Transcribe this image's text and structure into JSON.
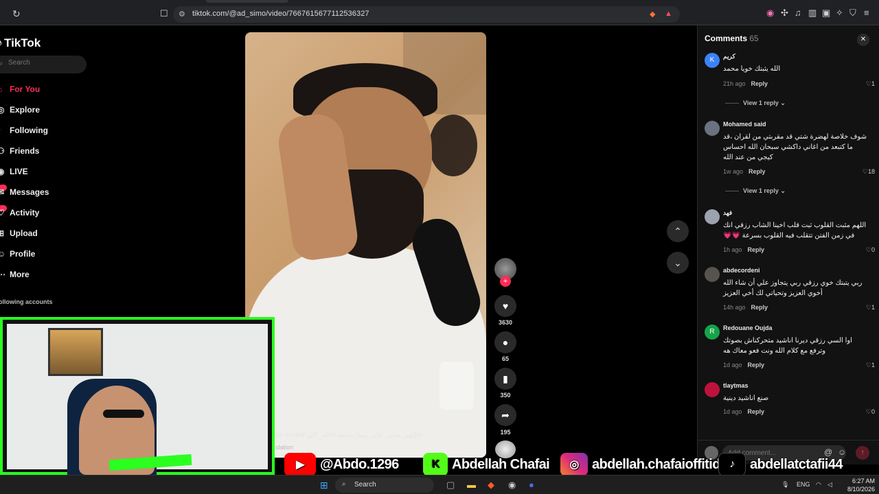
{
  "browser": {
    "url": "tiktok.com/@ad_simo/video/7667615677112536327"
  },
  "sidebar": {
    "logo": "TikTok",
    "search_placeholder": "Search",
    "items": [
      {
        "label": "For You",
        "icon": "home-icon"
      },
      {
        "label": "Explore",
        "icon": "compass-icon"
      },
      {
        "label": "Following",
        "icon": "following-icon"
      },
      {
        "label": "Friends",
        "icon": "friends-icon"
      },
      {
        "label": "LIVE",
        "icon": "live-icon"
      },
      {
        "label": "Messages",
        "icon": "messages-icon"
      },
      {
        "label": "Activity",
        "icon": "activity-icon"
      },
      {
        "label": "Upload",
        "icon": "upload-icon"
      },
      {
        "label": "Profile",
        "icon": "profile-icon"
      },
      {
        "label": "More",
        "icon": "more-icon"
      }
    ],
    "following_accounts_label": "ollowing accounts"
  },
  "video": {
    "caption": "#اللهم_صلي_على_نبينا_محمد #الله_اكبر #fyp #rizki",
    "translation_label": "slation"
  },
  "actions": {
    "likes": "3630",
    "comments": "65",
    "saves": "350",
    "shares": "195"
  },
  "comments_panel": {
    "title": "Comments",
    "count": "65",
    "comments": [
      {
        "avatar": "K",
        "avatar_color": "#3b82f6",
        "name": "كريم",
        "text": "الله يثبتك خويا محمد",
        "time": "21h ago",
        "reply": "Reply",
        "likes": "1",
        "view_replies": "View 1 reply"
      },
      {
        "avatar": "",
        "avatar_color": "#6b7280",
        "name": "Mohamed said",
        "text": "شوف خلاصة لهضرة شتي قد مقربتي من لقران ،قد ما كتبعد من اغاني داكشي سبحان الله احساس كيجي من عند الله",
        "time": "1w ago",
        "reply": "Reply",
        "likes": "18",
        "view_replies": "View 1 reply"
      },
      {
        "avatar": "",
        "avatar_color": "#9ca3af",
        "name": "فهد",
        "text": "اللهم مثبت القلوب ثبت قلب اخينا الشاب رزقي انك في زمن الفتن تتقلب فيه القلوب بسرعة 💗💗",
        "time": "1h ago",
        "reply": "Reply",
        "likes": "0"
      },
      {
        "avatar": "",
        "avatar_color": "#57534e",
        "name": "abdecordeni",
        "text": "ربي يتبتك خوي رزقي ربي يتجاوز علي أن شاء الله أخوي العزيز وتحياتي لك أخي العزيز",
        "time": "14h ago",
        "reply": "Reply",
        "likes": "1"
      },
      {
        "avatar": "R",
        "avatar_color": "#16a34a",
        "name": "Redouane Oujda",
        "text": "اوا السي رزقي ديرنا اناشيد متحركناش بصوتك وترفع مع كلام الله ونت فعو معاك هه",
        "time": "1d ago",
        "reply": "Reply",
        "likes": "1"
      },
      {
        "avatar": "",
        "avatar_color": "#be123c",
        "name": "tlaytmas",
        "text": "صنع اناشيد دينية",
        "time": "1d ago",
        "reply": "Reply",
        "likes": "0"
      }
    ],
    "add_comment_placeholder": "Add comment..."
  },
  "overlay_banner": {
    "youtube": "@Abdo.1296",
    "kick": "Abdellah Chafai",
    "instagram": "abdellah.chafaioffitid",
    "tiktok": "abdellatctafii44"
  },
  "taskbar": {
    "search_label": "Search",
    "language": "ENG",
    "time": "6:27 AM",
    "date": "8/10/2026"
  },
  "colors": {
    "accent": "#fe2c55",
    "webcam_border": "#2aff1f"
  }
}
